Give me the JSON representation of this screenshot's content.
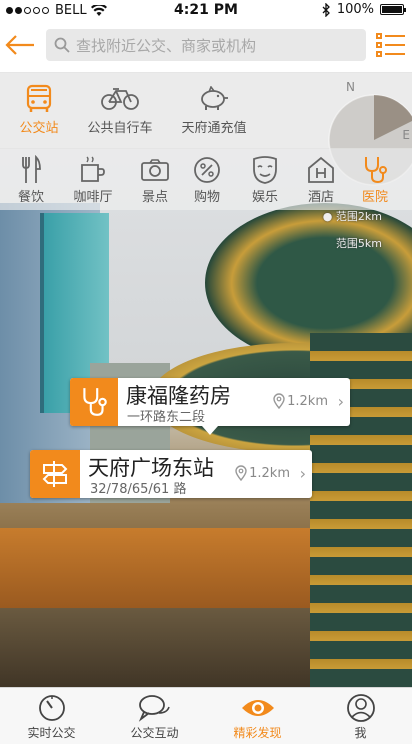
{
  "status_bar": {
    "carrier": "BELL",
    "time": "4:21 PM",
    "battery": "100%"
  },
  "nav": {
    "search_placeholder": "查找附近公交、商家或机构"
  },
  "categories_primary": [
    {
      "label": "公交站",
      "icon": "bus-icon",
      "active": true
    },
    {
      "label": "公共自行车",
      "icon": "bicycle-icon",
      "active": false
    },
    {
      "label": "天府通充值",
      "icon": "piggy-bank-icon",
      "active": false
    }
  ],
  "categories_secondary": [
    {
      "label": "餐饮",
      "icon": "fork-knife-icon",
      "active": false
    },
    {
      "label": "咖啡厅",
      "icon": "coffee-cup-icon",
      "active": false
    },
    {
      "label": "景点",
      "icon": "camera-icon",
      "active": false
    },
    {
      "label": "购物",
      "icon": "percent-tag-icon",
      "active": false
    },
    {
      "label": "娱乐",
      "icon": "mask-icon",
      "active": false
    },
    {
      "label": "酒店",
      "icon": "hotel-icon",
      "active": false
    },
    {
      "label": "医院",
      "icon": "stethoscope-icon",
      "active": true
    }
  ],
  "compass": {
    "north": "N",
    "east": "E"
  },
  "ranges": {
    "r1": "范围2km",
    "r2": "范围5km"
  },
  "poi_cards": [
    {
      "title": "康福隆药房",
      "subtitle": "一环路东二段",
      "distance": "1.2km",
      "icon": "stethoscope-icon"
    },
    {
      "title": "天府广场东站",
      "subtitle": "32/78/65/61 路",
      "distance": "1.2km",
      "icon": "signpost-icon"
    }
  ],
  "tabbar": [
    {
      "label": "实时公交",
      "icon": "clock-icon",
      "active": false
    },
    {
      "label": "公交互动",
      "icon": "chat-bubbles-icon",
      "active": false
    },
    {
      "label": "精彩发现",
      "icon": "eye-icon",
      "active": true
    },
    {
      "label": "我",
      "icon": "user-icon",
      "active": false
    }
  ],
  "colors": {
    "accent": "#f28a1c"
  }
}
